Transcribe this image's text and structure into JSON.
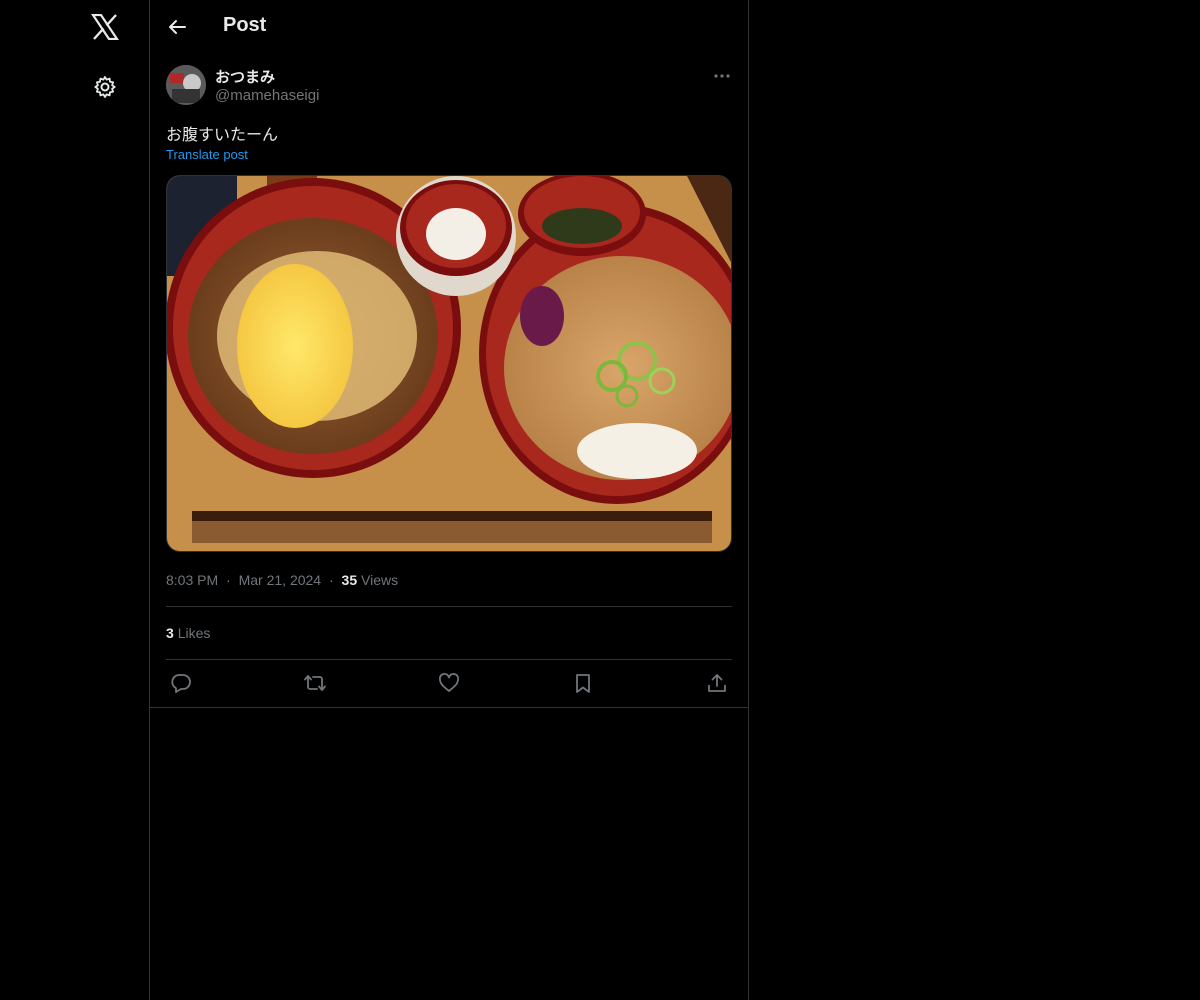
{
  "nav": {
    "logo_icon": "x-logo-icon",
    "settings_icon": "gear-icon"
  },
  "header": {
    "title": "Post",
    "back_icon": "arrow-left-icon"
  },
  "post": {
    "author_name": "おつまみ",
    "author_handle": "@mamehaseigi",
    "text": "お腹すいたーん",
    "translate_label": "Translate post",
    "media_description_icon": "photo",
    "time": "8:03 PM",
    "separator": "·",
    "date": "Mar 21, 2024",
    "views_count": "35",
    "views_label": "Views",
    "likes_count": "3",
    "likes_label": "Likes"
  },
  "actions": {
    "reply_icon": "reply-icon",
    "repost_icon": "repost-icon",
    "like_icon": "heart-icon",
    "bookmark_icon": "bookmark-icon",
    "share_icon": "share-icon"
  },
  "colors": {
    "background": "#000000",
    "text": "#e7e9ea",
    "muted": "#71767b",
    "accent": "#1d9bf0",
    "border": "#2f3336"
  }
}
